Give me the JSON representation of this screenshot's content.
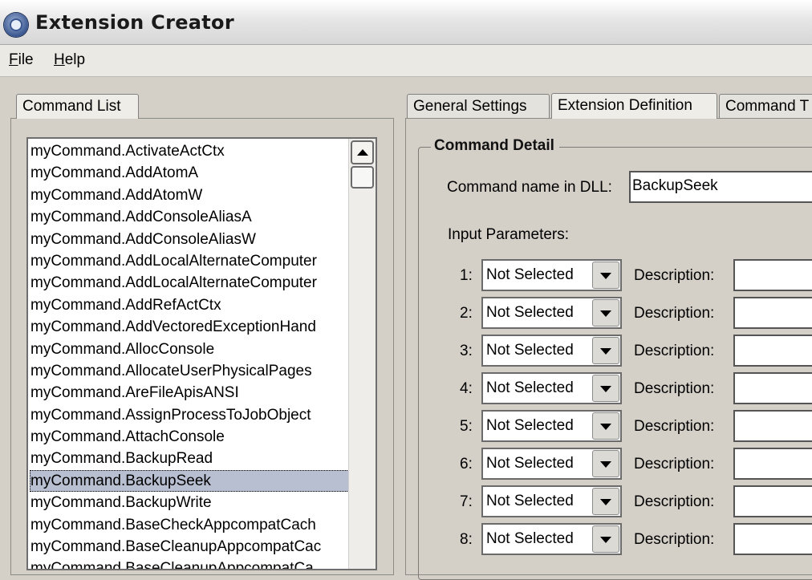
{
  "window": {
    "title": "Extension Creator"
  },
  "menu": {
    "file": "File",
    "help": "Help",
    "file_rest": "ile",
    "help_rest": "elp",
    "file_mn": "F",
    "help_mn": "H"
  },
  "left_tabs": {
    "command_list": "Command List"
  },
  "right_tabs": {
    "general": "General Settings",
    "extension": "Extension Definition",
    "command": "Command T"
  },
  "command_list": {
    "items": [
      "myCommand.ActivateActCtx",
      "myCommand.AddAtomA",
      "myCommand.AddAtomW",
      "myCommand.AddConsoleAliasA",
      "myCommand.AddConsoleAliasW",
      "myCommand.AddLocalAlternateComputer",
      "myCommand.AddLocalAlternateComputer",
      "myCommand.AddRefActCtx",
      "myCommand.AddVectoredExceptionHand",
      "myCommand.AllocConsole",
      "myCommand.AllocateUserPhysicalPages",
      "myCommand.AreFileApisANSI",
      "myCommand.AssignProcessToJobObject",
      "myCommand.AttachConsole",
      "myCommand.BackupRead",
      "myCommand.BackupSeek",
      "myCommand.BackupWrite",
      "myCommand.BaseCheckAppcompatCach",
      "myCommand.BaseCleanupAppcompatCac",
      "myCommand.BaseCleanupAppcompatCa"
    ],
    "selected_index": 15
  },
  "command_detail": {
    "title": "Command Detail",
    "name_label": "Command name in DLL:",
    "name_value": "BackupSeek",
    "input_params_label": "Input Parameters:",
    "description_label": "Description:",
    "params": [
      {
        "num": "1:",
        "value": "Not Selected"
      },
      {
        "num": "2:",
        "value": "Not Selected"
      },
      {
        "num": "3:",
        "value": "Not Selected"
      },
      {
        "num": "4:",
        "value": "Not Selected"
      },
      {
        "num": "5:",
        "value": "Not Selected"
      },
      {
        "num": "6:",
        "value": "Not Selected"
      },
      {
        "num": "7:",
        "value": "Not Selected"
      },
      {
        "num": "8:",
        "value": "Not Selected"
      }
    ]
  }
}
